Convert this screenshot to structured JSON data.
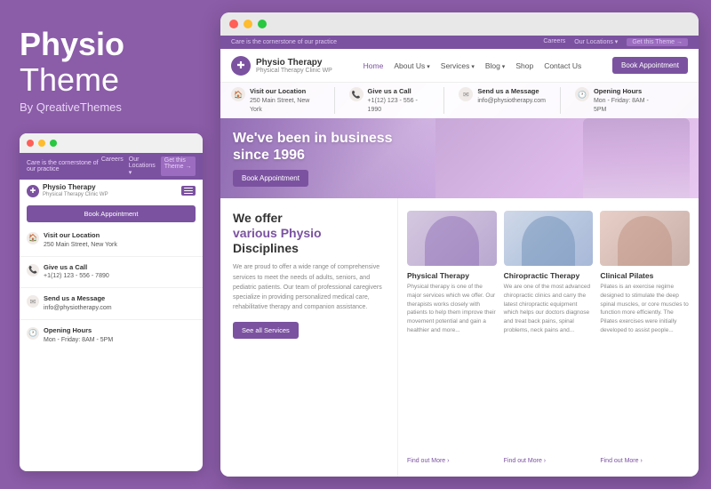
{
  "brand": {
    "name_bold": "Physio",
    "name_regular": "Theme",
    "author": "By QreativeThemes"
  },
  "small_browser": {
    "topbar": {
      "tagline": "Care is the cornerstone of our practice",
      "links": [
        "Careers",
        "Our Locations ▾",
        "Get this Theme →"
      ]
    },
    "appt_btn": "Book Appointment",
    "logo": {
      "icon": "✚",
      "name": "Physio Therapy",
      "sub": "Physical Therapy Clinic WP"
    },
    "info_rows": [
      {
        "icon": "🏠",
        "title": "Visit our Location",
        "detail": "250 Main Street, New York"
      },
      {
        "icon": "📞",
        "title": "Give us a Call",
        "detail": "+1(12) 123 - 556 - 7890"
      },
      {
        "icon": "✉",
        "title": "Send us a Message",
        "detail": "info@physiotherapy.com"
      },
      {
        "icon": "🕐",
        "title": "Opening Hours",
        "detail": "Mon - Friday: 8AM - 5PM"
      }
    ]
  },
  "site": {
    "topbar": {
      "tagline": "Care is the cornerstone of our practice",
      "links": [
        "Careers",
        "Our Locations ▾",
        "Get this Theme →"
      ]
    },
    "nav": {
      "logo_icon": "✚",
      "logo_name": "Physio Therapy",
      "logo_sub": "Physical Therapy Clinic WP",
      "links": [
        "Home",
        "About Us",
        "Services",
        "Blog",
        "Shop",
        "Contact Us"
      ],
      "active_link": "Home",
      "cta": "Book Appointment"
    },
    "hero": {
      "info_items": [
        {
          "icon": "🏠",
          "title": "Visit our Location",
          "detail": "250 Main Street, New York"
        },
        {
          "icon": "📞",
          "title": "Give us a Call",
          "detail": "+1(12) 123 - 556 - 1990"
        },
        {
          "icon": "✉",
          "title": "Send us a Message",
          "detail": "info@physiotherapy.com"
        },
        {
          "icon": "🕐",
          "title": "Opening Hours",
          "detail": "Mon - Friday: 8AM - 5PM"
        }
      ],
      "headline_line1": "We've been in business",
      "headline_line2": "since 1996",
      "cta": "Book Appointment"
    },
    "main": {
      "heading_line1": "We offer",
      "heading_line2": "various Physio",
      "heading_line3": "Disciplines",
      "body_text": "We are proud to offer a wide range of comprehensive services to meet the needs of adults, seniors, and pediatric patients. Our team of professional caregivers specialize in providing personalized medical care, rehabilitative therapy and companion assistance.",
      "services_btn": "See all Services",
      "cards": [
        {
          "title": "Physical Therapy",
          "text": "Physical therapy is one of the major services which we offer. Our therapists works closely with patients to help them improve their movement potential and gain a healthier and more...",
          "link": "Find out More"
        },
        {
          "title": "Chiropractic Therapy",
          "text": "We are one of the most advanced chiropractic clinics and carry the latest chiropractic equipment which helps our doctors diagnose and treat back pains, spinal problems, neck pains and...",
          "link": "Find out More"
        },
        {
          "title": "Clinical Pilates",
          "text": "Pilates is an exercise regime designed to stimulate the deep spinal muscles, or core muscles to function more efficiently. The Pilates exercises were initially developed to assist people...",
          "link": "Find out More"
        }
      ]
    }
  },
  "colors": {
    "purple": "#7b52a0",
    "light_purple": "#8b5ca8",
    "text_dark": "#333333",
    "text_muted": "#888888"
  }
}
